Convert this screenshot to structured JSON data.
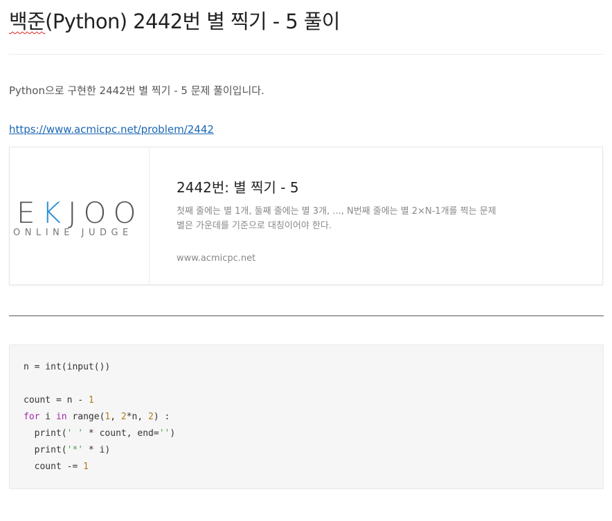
{
  "post": {
    "title_prefix": "백준",
    "title_rest": "(Python) 2442번 별 찍기 - 5 풀이",
    "intro": "Python으로 구현한 2442번 별 찍기 - 5 문제 풀이입니다.",
    "link": "https://www.acmicpc.net/problem/2442"
  },
  "card": {
    "logo_main_left": "E",
    "logo_main_k": "K",
    "logo_main_right": "JOO",
    "logo_sub": "ONLINE JUDGE",
    "title": "2442번: 별 찍기 - 5",
    "description": "첫째 줄에는 별 1개, 둘째 줄에는 별 3개, ..., N번째 줄에는 별 2×N-1개를 찍는 문제 별은 가운데를 기준으로 대칭이어야 한다.",
    "url": "www.acmicpc.net"
  },
  "code": {
    "lines": [
      "n = int(input())",
      "",
      "count = n - 1",
      "for i in range(1, 2*n, 2) :",
      "  print(' ' * count, end='')",
      "  print('*' * i)",
      "  count -= 1"
    ]
  }
}
